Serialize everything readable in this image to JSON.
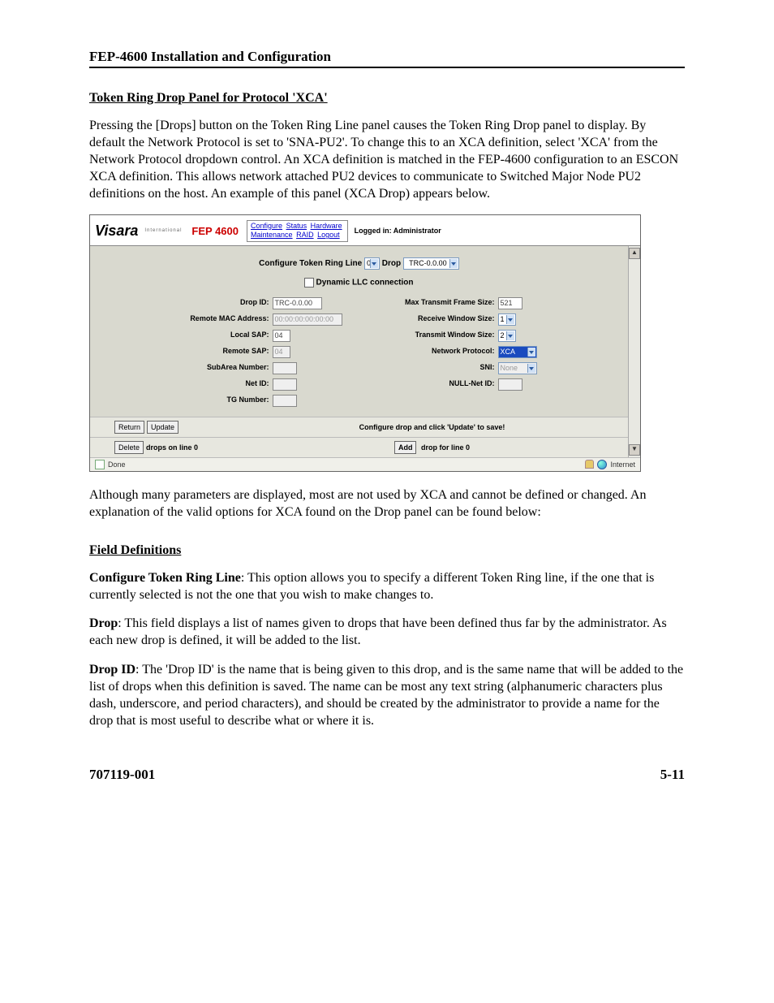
{
  "page": {
    "header": "FEP-4600 Installation and Configuration",
    "section_title": "Token Ring Drop Panel for Protocol 'XCA'",
    "intro_para": "Pressing the [Drops] button on the Token Ring Line panel causes the Token Ring Drop panel to display. By default the Network Protocol is set to 'SNA-PU2'. To change this to an XCA definition, select 'XCA' from the Network Protocol dropdown control. An XCA definition is matched in the FEP-4600 configuration to an ESCON XCA definition. This allows network attached PU2 devices to communicate to Switched Major Node PU2 definitions on the host. An example of this panel (XCA Drop) appears below.",
    "post_para": "Although many parameters are displayed, most are not used by XCA and cannot be defined or changed. An explanation of the valid options for XCA found on the Drop panel can be found below:",
    "field_def_heading": "Field Definitions",
    "defs": {
      "d1_term": "Configure Token Ring Line",
      "d1_text": ":  This option allows you to specify a different Token Ring line, if the one that is currently selected is not the one that you wish to make changes to.",
      "d2_term": "Drop",
      "d2_text": ":  This field displays a list of names given to drops that have been defined thus far by the administrator. As each new drop is defined, it will be added to the list.",
      "d3_term": "Drop ID",
      "d3_text": ":  The 'Drop ID' is the name that is being given to this drop, and is the same name that will be added to the list of drops when this definition is saved. The name can be most any text string (alphanumeric characters plus dash, underscore, and period characters), and should be created by the administrator to provide a name for the drop that is most useful to describe what or where it is."
    },
    "footer_left": "707119-001",
    "footer_right": "5-11"
  },
  "embed": {
    "logo1": "Visara",
    "logo_sub": "International",
    "logo2": "FEP 4600",
    "nav": {
      "row1": [
        "Configure",
        "Status",
        "Hardware"
      ],
      "row2": [
        "Maintenance",
        "RAID",
        "Logout"
      ]
    },
    "loggedin": "Logged in: Administrator",
    "title_prefix": "Configure Token Ring Line",
    "line_sel": "0",
    "title_mid": "Drop",
    "drop_sel": "TRC-0.0.00",
    "dynamic_llc": "Dynamic LLC connection",
    "rows": {
      "drop_id_l": "Drop ID:",
      "drop_id_v": "TRC-0.0.00",
      "mtfs_l": "Max Transmit Frame Size:",
      "mtfs_v": "521",
      "rmac_l": "Remote MAC Address:",
      "rmac_v": "00:00:00:00:00:00",
      "rws_l": "Receive Window Size:",
      "rws_v": "1",
      "lsap_l": "Local SAP:",
      "lsap_v": "04",
      "tws_l": "Transmit Window Size:",
      "tws_v": "2",
      "rsap_l": "Remote SAP:",
      "rsap_v": "04",
      "np_l": "Network Protocol:",
      "np_v": "XCA",
      "subarea_l": "SubArea Number:",
      "sni_l": "SNI:",
      "sni_v": "None",
      "netid_l": "Net ID:",
      "nullnet_l": "NULL-Net ID:",
      "tg_l": "TG Number:"
    },
    "buttons": {
      "return": "Return",
      "update": "Update",
      "delete": "Delete",
      "add": "Add"
    },
    "bar1_msg": "Configure drop and click 'Update' to save!",
    "bar2_left": "drops on line 0",
    "bar2_right": "drop for line 0",
    "status_done": "Done",
    "status_zone": "Internet"
  }
}
